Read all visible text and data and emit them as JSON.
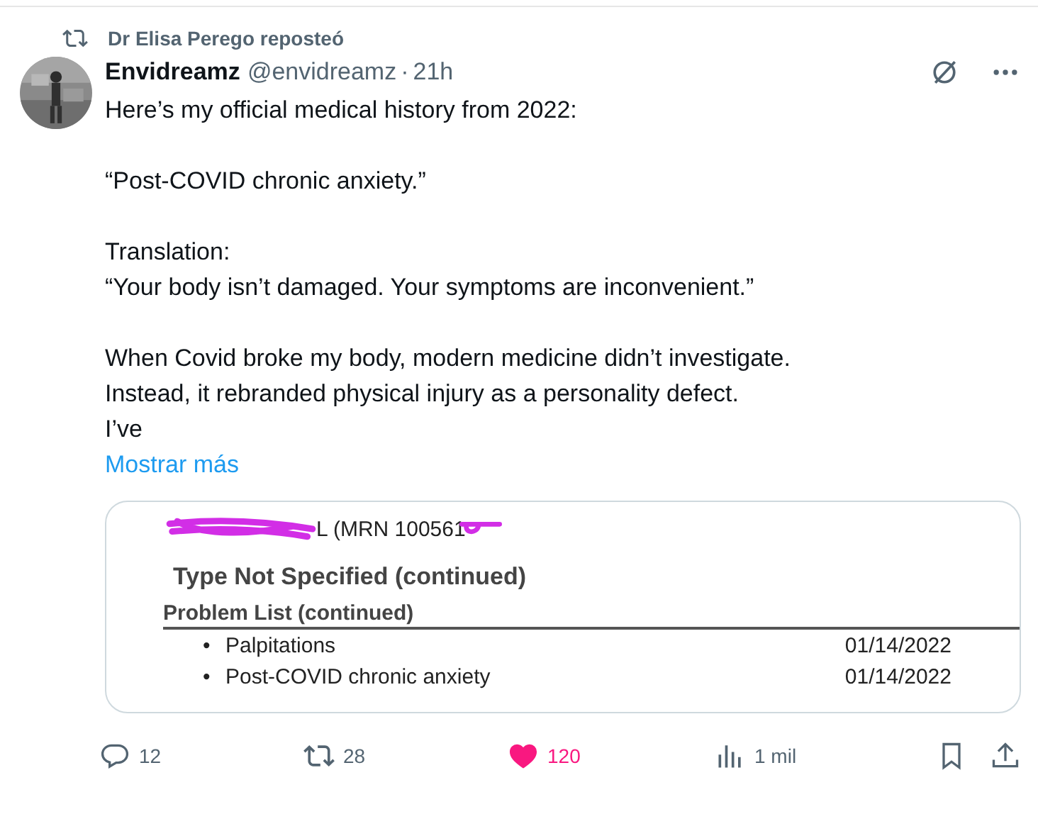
{
  "repost": {
    "label": "Dr Elisa Perego reposteó"
  },
  "post": {
    "author": "Envidreamz",
    "handle": "@envidreamz",
    "separator": "·",
    "time": "21h",
    "paragraphs": [
      "Here’s my official medical history from 2022:",
      "“Post-COVID chronic anxiety.”",
      "Translation:\n“Your body isn’t damaged. Your symptoms are inconvenient.”",
      "When Covid broke my body, modern medicine didn’t investigate.\nInstead, it rebranded physical injury as a personality defect.\nI’ve"
    ],
    "more_link": "Mostrar más"
  },
  "document": {
    "header": "L (MRN 100561",
    "title": "Type Not Specified (continued)",
    "section": "Problem List (continued)",
    "rows": [
      {
        "bullet": "•",
        "item": "Palpitations",
        "date": "01/14/2022"
      },
      {
        "bullet": "•",
        "item": "Post-COVID chronic anxiety",
        "date": "01/14/2022"
      }
    ]
  },
  "actions": [
    {
      "kind": "reply",
      "count": "12",
      "selected": false
    },
    {
      "kind": "repost",
      "count": "28",
      "selected": false
    },
    {
      "kind": "like",
      "count": "120",
      "selected": true
    },
    {
      "kind": "views",
      "count": "1 mil",
      "selected": false
    }
  ]
}
